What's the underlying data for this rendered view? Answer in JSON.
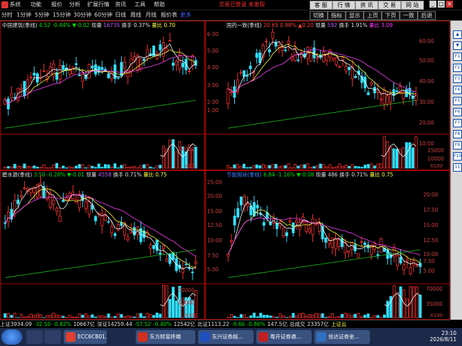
{
  "menubar": {
    "items": [
      "系统",
      "功能",
      "报价",
      "分析",
      "扩展行情",
      "资讯",
      "工具",
      "帮助"
    ],
    "center_note": "交易已登录 未发现",
    "right_buttons": [
      "客 服",
      "行 情",
      "资 讯",
      "交 易",
      "网 站"
    ]
  },
  "toolbar": {
    "periods": [
      "分时",
      "1分钟",
      "5分钟",
      "15分钟",
      "30分钟",
      "60分钟",
      "日线",
      "周线",
      "月线",
      "报价表",
      "更多"
    ],
    "buttons": [
      "切换",
      "指标",
      "显示",
      "上页",
      "下页",
      "一致",
      "后退"
    ]
  },
  "panels": [
    {
      "name": "中国建筑(季线)",
      "price": "4.52",
      "change_pct": "-0.44%",
      "change": "▼-0.02",
      "volume_label": "现量",
      "volume": "16735",
      "turnover": "换手 0.37%",
      "volume_ratio": "量比 0.70",
      "price_axis": [],
      "volume_axis": [
        "10000"
      ],
      "unit": "X1万"
    },
    {
      "name": "国药一致(季线)",
      "price": "20.65",
      "change_pct": "0.98%",
      "change": "▲0.20",
      "volume_label": "现量",
      "volume": "592",
      "turnover": "换手 1.91%",
      "volume_ratio": "量比 3.09",
      "price_axis": [
        "60.00",
        "50.00",
        "40.00",
        "30.00",
        "20.00",
        "10.00"
      ],
      "left_axis": [
        "6.00",
        "5.00",
        "4.00",
        "3.00",
        "2.00",
        "1.00"
      ],
      "volume_axis": [
        "15000",
        "10000"
      ],
      "unit": "X100"
    },
    {
      "name": "碧水源(季线)",
      "price": "3.50",
      "change_pct": "-0.28%",
      "change": "▼-0.01",
      "volume_label": "现量",
      "volume": "4558",
      "turnover": "换手 0.71%",
      "volume_ratio": "量比 0.75",
      "price_axis": [],
      "volume_axis": [
        "20000",
        "10000"
      ],
      "unit": "X100"
    },
    {
      "name": "节能国祯(季线)",
      "price": "6.84",
      "change_pct": "-1.16%",
      "change": "▼-0.08",
      "volume_label": "现量",
      "volume": "486",
      "turnover": "换手 0.71%",
      "volume_ratio": "量比 0.75",
      "price_axis": [
        "20.00",
        "17.50",
        "15.00",
        "12.50",
        "10.00",
        "7.50",
        "5.00"
      ],
      "left_axis": [
        "25.00",
        "20.00",
        "15.00",
        "12.50",
        "10.00",
        "7.50",
        "5.00"
      ],
      "volume_axis": [
        "70000",
        "35000"
      ],
      "unit": "X100"
    }
  ],
  "statusbar": [
    {
      "text": "上证3934.09",
      "cls": "wt"
    },
    {
      "text": "-32.50",
      "cls": "dn"
    },
    {
      "text": "-0.82%",
      "cls": "dn"
    },
    {
      "text": "10667亿",
      "cls": "wt"
    },
    {
      "text": "深证14259.44",
      "cls": "wt"
    },
    {
      "text": "-57.52",
      "cls": "dn"
    },
    {
      "text": "-0.40%",
      "cls": "dn"
    },
    {
      "text": "12542亿",
      "cls": "wt"
    },
    {
      "text": "北证1113.22",
      "cls": "wt"
    },
    {
      "text": "-9.66",
      "cls": "dn"
    },
    {
      "text": "-0.86%",
      "cls": "dn"
    },
    {
      "text": "147.5亿",
      "cls": "wt"
    },
    {
      "text": "总成交",
      "cls": "wt"
    },
    {
      "text": "23357亿",
      "cls": "wt"
    },
    {
      "text": "上证云",
      "cls": "yl"
    }
  ],
  "taskbar": {
    "tasks": [
      {
        "label": "ECC6CB01...",
        "color": "#e04030"
      },
      {
        "label": "东方财富终端",
        "color": "#d03020"
      },
      {
        "label": "东兴证券超...",
        "color": "#2050c0"
      },
      {
        "label": "粤开证券通...",
        "color": "#c02020"
      },
      {
        "label": "信达证券金...",
        "color": "#3070c0"
      }
    ],
    "time": "23:10",
    "date": "2026/8/11"
  },
  "sidebar_icons": [
    "▲",
    "▼",
    "F1",
    "F2",
    "F3",
    "F4",
    "F5",
    "F6",
    "F7",
    "F8",
    "F9",
    "F10",
    "11"
  ]
}
